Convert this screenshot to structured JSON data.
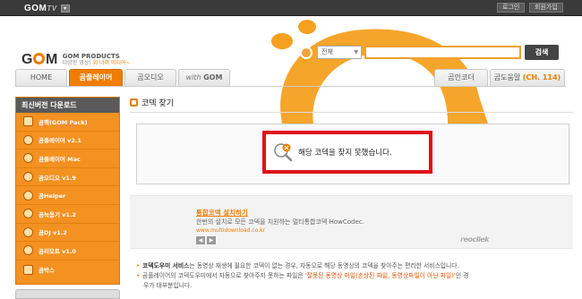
{
  "topbar": {
    "logo": "GOM",
    "logo_suffix": "TV",
    "login": "로그인",
    "signup": "회원가입"
  },
  "brand": {
    "products": "GOM PRODUCTS",
    "tagline_prefix": "다양한 영상!",
    "tagline_highlight": "위 너머 미디어~"
  },
  "search": {
    "select_value": "전체",
    "button": "검색"
  },
  "tabs": {
    "home": "HOME",
    "player": "곰플레이어",
    "audio": "곰오디오",
    "with_gom_prefix": "with",
    "with_gom": "GOM",
    "codec": "곰인코더",
    "download": "곰도움말",
    "download_count": "(CH. 114)"
  },
  "sidebar": {
    "title": "최신버전 다운로드",
    "items": [
      {
        "label": "곰팩(GOM Pack)"
      },
      {
        "label": "곰플레이어 v2.1"
      },
      {
        "label": "곰플레이어 Mac"
      },
      {
        "label": "곰오디오 v1.9"
      },
      {
        "label": "곰Helper"
      },
      {
        "label": "곰녹음기 v1.2"
      },
      {
        "label": "곰DJ v1.2"
      },
      {
        "label": "곰리모트 v1.0"
      },
      {
        "label": "곰박스"
      }
    ]
  },
  "page": {
    "title": "코덱 찾기",
    "alert": "해당 코덱을 찾지 못했습니다."
  },
  "ad": {
    "link": "통합코덱 설치하기",
    "desc": "한번의 설치로 모든 코덱을 지원하는 멀티통합코덱 HowCodec.",
    "url": "www.multidownload.co.kr",
    "brand": "reocliek"
  },
  "note": {
    "line1_bold": "코덱도우미 서비스",
    "line1_rest": "는 동영상 재생에 필요한 코덱이 없는 경우, 자동으로 해당 동영상의 코덱을 찾아주는 편리한 서비스입니다.",
    "line2_pre": "곰플레이어의 코덱도우미에서 자동으로 찾아주지 못하는 파일은 ",
    "line2_hl": "'잘못된 동영상 파일(손상된 파일, 동영상파일이 아닌 파일)'",
    "line2_post": "인 경",
    "line3": "우가 대부분입니다."
  },
  "colors": {
    "accent": "#f07c00",
    "alert_border": "#e0101a",
    "topbar": "#3a3a3a"
  }
}
